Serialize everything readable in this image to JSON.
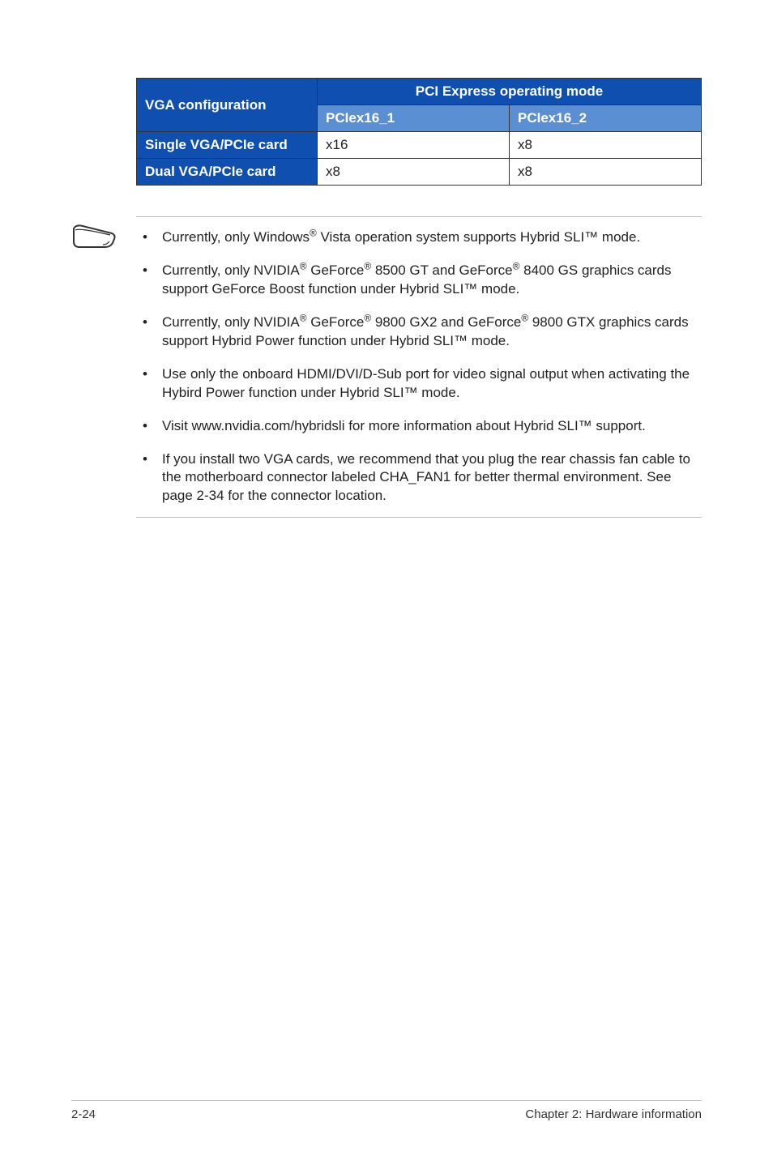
{
  "table": {
    "header_col1": "VGA configuration",
    "header_merged": "PCI Express operating mode",
    "header_sub1": "PCIex16_1",
    "header_sub2": "PCIex16_2",
    "rows": [
      {
        "label": "Single VGA/PCIe card",
        "c1": "x16",
        "c2": "x8"
      },
      {
        "label": "Dual VGA/PCIe card",
        "c1": "x8",
        "c2": "x8"
      }
    ]
  },
  "notes": {
    "0": {
      "pre": "Currently, only Windows",
      "sup": "®",
      "post": " Vista operation system supports Hybrid SLI™ mode."
    },
    "1": {
      "pre": "Currently, only NVIDIA",
      "sup1": "®",
      "mid1": " GeForce",
      "sup2": "®",
      "mid2": " 8500 GT and GeForce",
      "sup3": "®",
      "post": " 8400 GS graphics cards support GeForce Boost function under Hybrid SLI™ mode."
    },
    "2": {
      "pre": "Currently, only NVIDIA",
      "sup1": "®",
      "mid1": " GeForce",
      "sup2": "®",
      "mid2": " 9800 GX2 and GeForce",
      "sup3": "®",
      "post": " 9800 GTX graphics cards support Hybrid Power function under Hybrid SLI™ mode."
    },
    "3": {
      "text": "Use only the onboard HDMI/DVI/D-Sub port for video signal output when activating the Hybird Power function under Hybrid SLI™ mode."
    },
    "4": {
      "text": "Visit www.nvidia.com/hybridsli for more information about Hybrid SLI™ support."
    },
    "5": {
      "text": "If you install two VGA cards, we recommend that you plug the rear chassis fan cable to the motherboard connector labeled CHA_FAN1 for better thermal environment. See page 2-34 for the connector location."
    }
  },
  "footer": {
    "left": "2-24",
    "right": "Chapter 2: Hardware information"
  }
}
